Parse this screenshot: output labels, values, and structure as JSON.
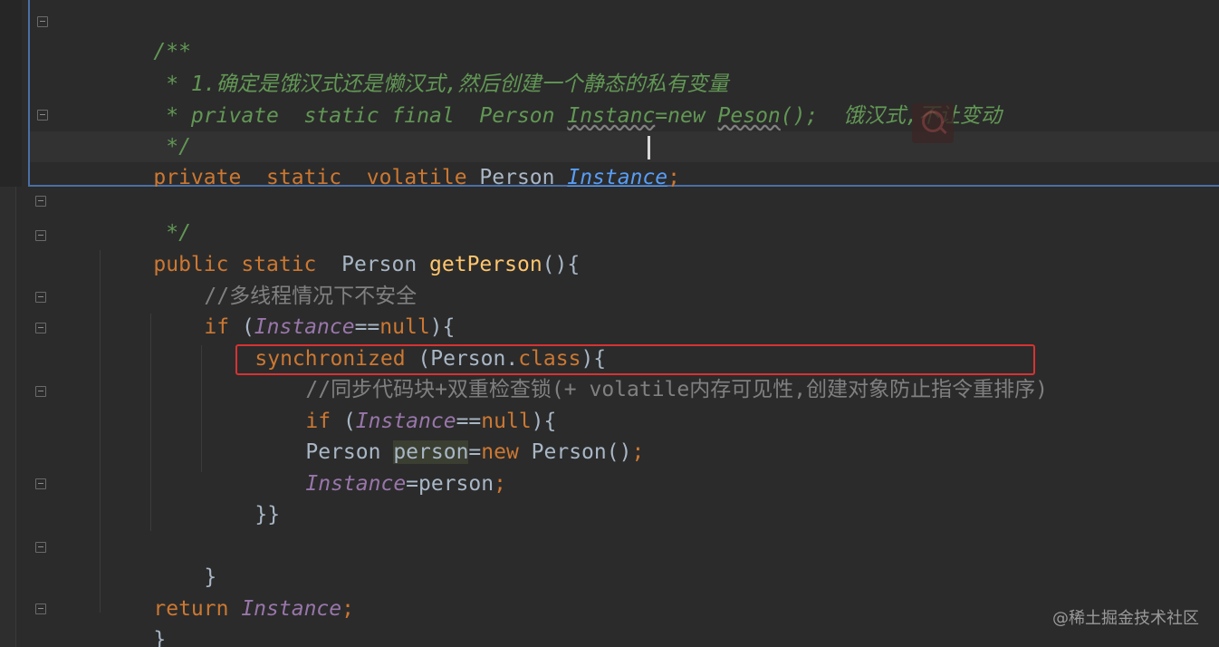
{
  "editor": {
    "top": {
      "l1": "/**",
      "l2": " * 1.确定是饿汉式还是懒汉式,然后创建一个静态的私有变量",
      "l3a": " * private  static final  Person ",
      "l3b": "Instanc",
      "l3c": "=new ",
      "l3d": "Peson",
      "l3e": "();",
      "l3f": "  饿汉式,不让变动",
      "l4": " */",
      "l5a": "private  static  volatile ",
      "l5b": "Person ",
      "l5c": "Instance",
      "l5d": ";"
    },
    "bottom": {
      "l1": " */",
      "l2a": "public static  ",
      "l2b": "Person ",
      "l2c": "getPerson",
      "l2d": "(){",
      "l3": "//多线程情况下不安全",
      "l4a": "if ",
      "l4b": "(",
      "l4c": "Instance",
      "l4d": "==",
      "l4e": "null",
      "l4f": "){",
      "l5a": "synchronized ",
      "l5b": "(Person.",
      "l5c": "class",
      "l5d": "){",
      "l6": "//同步代码块+双重检查锁(+ volatile内存可见性,创建对象防止指令重排序)",
      "l7a": "if ",
      "l7b": "(",
      "l7c": "Instance",
      "l7d": "==",
      "l7e": "null",
      "l7f": "){",
      "l8a": "Person ",
      "l8b": "person",
      "l8c": "=",
      "l8d": "new ",
      "l8e": "Person()",
      "l8f": ";",
      "l9a": "Instance",
      "l9b": "=person",
      "l9c": ";",
      "l10": "}}",
      "l12": "}",
      "l13a": "return ",
      "l13b": "Instance",
      "l13c": ";",
      "l14": "}"
    }
  },
  "watermark": "@稀土掘金技术社区",
  "icons": {
    "fold": "fold-marker-icon",
    "search": "search-icon"
  },
  "colors": {
    "background": "#2b2b2b",
    "keyword": "#cc7832",
    "comment": "#629755",
    "field": "#9876aa",
    "method": "#ffc66d",
    "highlight_box": "#d73232"
  }
}
